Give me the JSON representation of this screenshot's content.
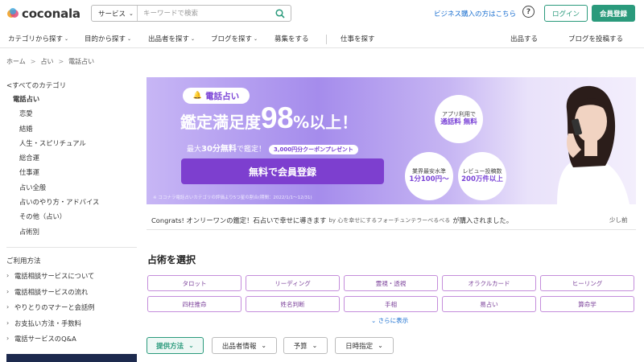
{
  "brand": {
    "name": "coconala"
  },
  "search": {
    "category": "サービス",
    "placeholder": "キーワードで検索"
  },
  "header": {
    "business_link": "ビジネス購入の方はこちら",
    "login": "ログイン",
    "register": "会員登録"
  },
  "nav": {
    "items": [
      "カテゴリから探す",
      "目的から探す",
      "出品者を探す",
      "ブログを探す",
      "募集をする",
      "仕事を探す"
    ],
    "right": [
      "出品する",
      "ブログを投稿する"
    ]
  },
  "breadcrumb": [
    "ホーム",
    "占い",
    "電話占い"
  ],
  "sidebar": {
    "all_categories": "すべてのカテゴリ",
    "categories": [
      "電話占い",
      "恋愛",
      "結婚",
      "人生・スピリチュアル",
      "総合運",
      "仕事運",
      "占い全般",
      "占いのやり方・アドバイス",
      "その他（占い）",
      "占術別"
    ],
    "guide_title": "ご利用方法",
    "guides": [
      "電話相談サービスについて",
      "電話相談サービスの流れ",
      "やりとりのマナーと会話例",
      "お支払い方法・手数料",
      "電話サービスのQ&A"
    ]
  },
  "banner": {
    "tag": "電話占い",
    "headline_lead": "鑑定満足度",
    "headline_big": "98",
    "headline_tail": "%以上！",
    "free_prefix": "最大",
    "free_bold": "30分無料",
    "free_suffix": "で鑑定！",
    "coupon": "3,000円分クーポンプレゼント",
    "cta": "無料で会員登録",
    "note": "※ ココナラ電話占いカテゴリの評価より5つ星の割合(期間：2022/1/1～12/31)",
    "bubbles": [
      {
        "small": "アプリ利用で",
        "big": "通話料 無料"
      },
      {
        "small": "業界最安水準",
        "big": "1分100円～"
      },
      {
        "small": "レビュー投稿数",
        "big": "200万件以上"
      }
    ]
  },
  "ticker": {
    "lead": "Congrats! オンリーワンの鑑定！石占いで幸せに導きます",
    "by": "by 心を幸せにするフォーチュンテラーべるべる",
    "tail": "が購入されました。",
    "time": "少し前"
  },
  "fortune": {
    "title": "占術を選択",
    "types": [
      "タロット",
      "リーディング",
      "霊視・透視",
      "オラクルカード",
      "ヒーリング",
      "四柱推命",
      "姓名判断",
      "手相",
      "易占い",
      "算命学"
    ],
    "more": "さらに表示"
  },
  "filters": [
    "提供方法",
    "出品者情報",
    "予算",
    "日時指定"
  ],
  "colors": {
    "accent": "#2a9a7c",
    "banner_purple": "#7d3fcf",
    "link": "#1a6fd0"
  }
}
